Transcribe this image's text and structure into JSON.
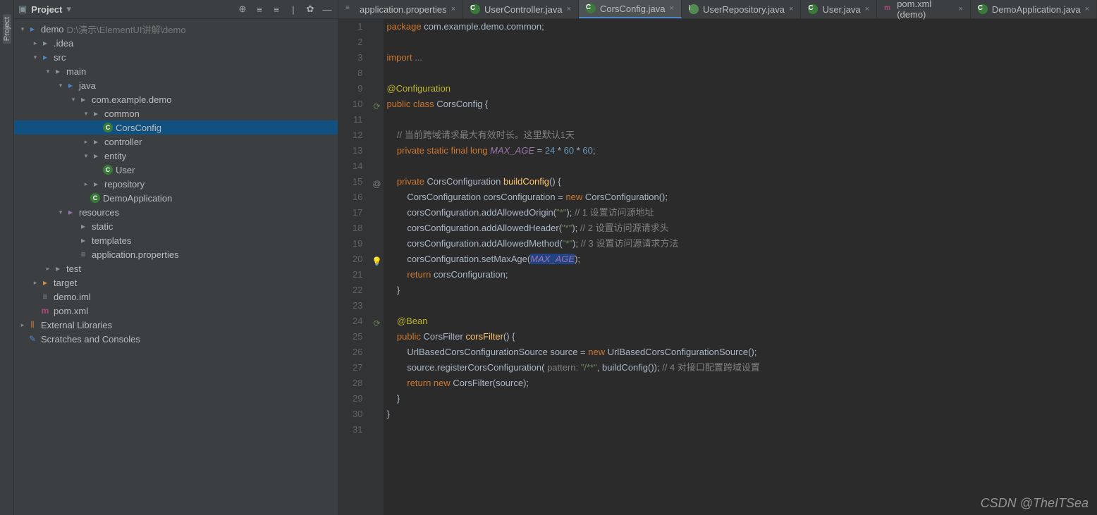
{
  "sidebar_label": "Project",
  "project_header": {
    "title": "Project",
    "dropdown": "▾"
  },
  "project_root": {
    "name": "demo",
    "path": "D:\\演示\\ElementUI讲解\\demo"
  },
  "tree": [
    {
      "indent": 0,
      "arrow": "v",
      "icon": "folder-blue",
      "label": "demo",
      "path": "D:\\演示\\ElementUI讲解\\demo"
    },
    {
      "indent": 1,
      "arrow": ">",
      "icon": "folder",
      "label": ".idea"
    },
    {
      "indent": 1,
      "arrow": "v",
      "icon": "folder-blue",
      "label": "src"
    },
    {
      "indent": 2,
      "arrow": "v",
      "icon": "folder",
      "label": "main"
    },
    {
      "indent": 3,
      "arrow": "v",
      "icon": "folder-blue",
      "label": "java"
    },
    {
      "indent": 4,
      "arrow": "v",
      "icon": "folder",
      "label": "com.example.demo"
    },
    {
      "indent": 5,
      "arrow": "v",
      "icon": "folder",
      "label": "common"
    },
    {
      "indent": 6,
      "arrow": "",
      "icon": "java-c",
      "label": "CorsConfig",
      "selected": true
    },
    {
      "indent": 5,
      "arrow": ">",
      "icon": "folder",
      "label": "controller"
    },
    {
      "indent": 5,
      "arrow": "v",
      "icon": "folder",
      "label": "entity"
    },
    {
      "indent": 6,
      "arrow": "",
      "icon": "java-c",
      "label": "User"
    },
    {
      "indent": 5,
      "arrow": ">",
      "icon": "folder",
      "label": "repository"
    },
    {
      "indent": 5,
      "arrow": "",
      "icon": "java-c",
      "label": "DemoApplication"
    },
    {
      "indent": 3,
      "arrow": "v",
      "icon": "res",
      "label": "resources"
    },
    {
      "indent": 4,
      "arrow": "",
      "icon": "folder",
      "label": "static"
    },
    {
      "indent": 4,
      "arrow": "",
      "icon": "folder",
      "label": "templates"
    },
    {
      "indent": 4,
      "arrow": "",
      "icon": "prop",
      "label": "application.properties"
    },
    {
      "indent": 2,
      "arrow": ">",
      "icon": "folder",
      "label": "test"
    },
    {
      "indent": 1,
      "arrow": ">",
      "icon": "folder-orange",
      "label": "target"
    },
    {
      "indent": 1,
      "arrow": "",
      "icon": "prop",
      "label": "demo.iml"
    },
    {
      "indent": 1,
      "arrow": "",
      "icon": "maven",
      "label": "pom.xml"
    },
    {
      "indent": 0,
      "arrow": ">",
      "icon": "lib",
      "label": "External Libraries"
    },
    {
      "indent": 0,
      "arrow": "",
      "icon": "scratch",
      "label": "Scratches and Consoles"
    }
  ],
  "tabs": [
    {
      "icon": "prop",
      "label": "application.properties",
      "active": false
    },
    {
      "icon": "java-c",
      "label": "UserController.java",
      "active": false
    },
    {
      "icon": "java-c",
      "label": "CorsConfig.java",
      "active": true
    },
    {
      "icon": "java-i",
      "label": "UserRepository.java",
      "active": false
    },
    {
      "icon": "java-c",
      "label": "User.java",
      "active": false
    },
    {
      "icon": "maven",
      "label": "pom.xml (demo)",
      "active": false
    },
    {
      "icon": "java-c",
      "label": "DemoApplication.java",
      "active": false
    }
  ],
  "line_numbers": [
    "1",
    "2",
    "3",
    "8",
    "9",
    "10",
    "11",
    "12",
    "13",
    "14",
    "15",
    "16",
    "17",
    "18",
    "19",
    "20",
    "21",
    "22",
    "23",
    "24",
    "25",
    "26",
    "27",
    "28",
    "29",
    "30",
    "31"
  ],
  "gutter_icons": [
    {
      "line_idx": 5,
      "glyph": "⟳",
      "color": "#6a8759"
    },
    {
      "line_idx": 10,
      "glyph": "@",
      "color": "#808080"
    },
    {
      "line_idx": 15,
      "glyph": "💡",
      "color": "#f0a732"
    },
    {
      "line_idx": 19,
      "glyph": "⟳",
      "color": "#6a8759"
    }
  ],
  "code": {
    "l1": "package",
    "l1b": " com.example.demo.common;",
    "l3": "import",
    "l3b": " ...",
    "l5": "@Configuration",
    "l6a": "public class ",
    "l6b": "CorsConfig ",
    "l6c": "{",
    "l8": "    // 当前跨域请求最大有效时长。这里默认1天",
    "l9a": "    private static final long ",
    "l9b": "MAX_AGE",
    "l9c": " = ",
    "l9d": "24",
    "l9e": " * ",
    "l9f": "60",
    "l9g": " * ",
    "l9h": "60",
    "l9i": ";",
    "l11a": "    private ",
    "l11b": "CorsConfiguration ",
    "l11c": "buildConfig",
    "l11d": "() {",
    "l12a": "        CorsConfiguration corsConfiguration = ",
    "l12b": "new ",
    "l12c": "CorsConfiguration();",
    "l13a": "        corsConfiguration.addAllowedOrigin(",
    "l13b": "\"*\"",
    "l13c": "); ",
    "l13d": "// 1 设置访问源地址",
    "l14a": "        corsConfiguration.addAllowedHeader(",
    "l14b": "\"*\"",
    "l14c": "); ",
    "l14d": "// 2 设置访问源请求头",
    "l15a": "        corsConfiguration.addAllowedMethod(",
    "l15b": "\"*\"",
    "l15c": "); ",
    "l15d": "// 3 设置访问源请求方法",
    "l16a": "        corsConfiguration.setMaxAge(",
    "l16b": "MAX_AGE",
    "l16c": ");",
    "l17a": "        return ",
    "l17b": "corsConfiguration;",
    "l18": "    }",
    "l20": "    @Bean",
    "l21a": "    public ",
    "l21b": "CorsFilter ",
    "l21c": "corsFilter",
    "l21d": "() {",
    "l22a": "        UrlBasedCorsConfigurationSource source = ",
    "l22b": "new ",
    "l22c": "UrlBasedCorsConfigurationSource();",
    "l23a": "        source.registerCorsConfiguration( ",
    "l23p": "pattern: ",
    "l23b": "\"/**\"",
    "l23c": ", buildConfig()); ",
    "l23d": "// 4 对接口配置跨域设置",
    "l24a": "        return new ",
    "l24b": "CorsFilter(source);",
    "l25": "    }",
    "l26": "}"
  },
  "watermark": "CSDN @TheITSea"
}
